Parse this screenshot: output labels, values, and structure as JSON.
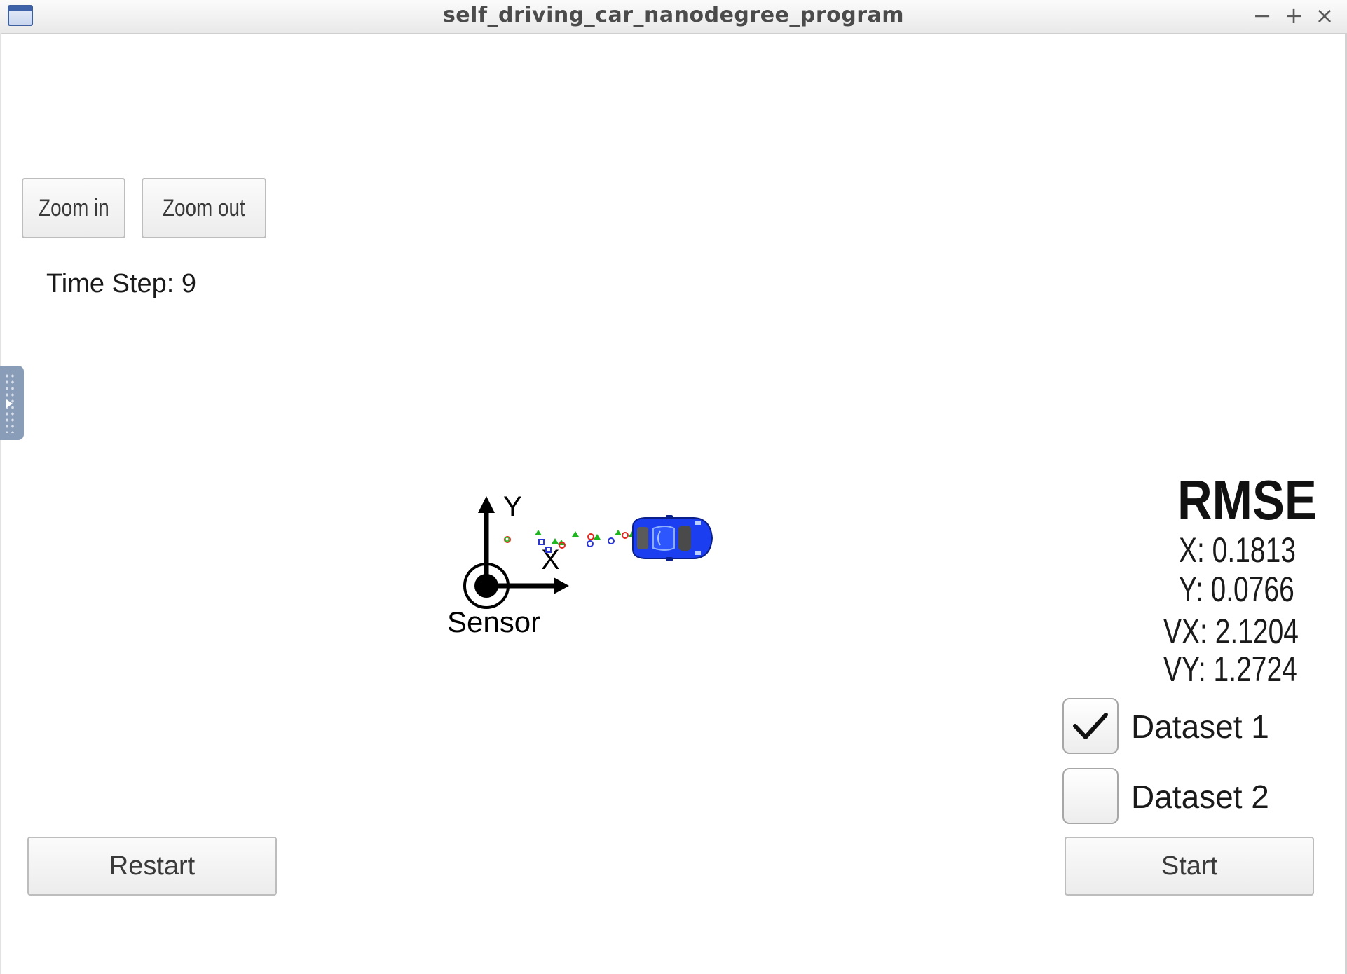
{
  "window": {
    "title": "self_driving_car_nanodegree_program",
    "minimize_label": "−",
    "maximize_label": "+",
    "close_label": "×"
  },
  "toolbar": {
    "zoom_in_label": "Zoom in",
    "zoom_out_label": "Zoom out"
  },
  "status": {
    "time_step": "Time Step: 9"
  },
  "scene": {
    "axis_x_label": "X",
    "axis_y_label": "Y",
    "sensor_label": "Sensor",
    "car_color": "#1a3ef0",
    "lidar_marker_color": "#e0281e",
    "radar_marker_color": "#2a35d8",
    "estimate_marker_color": "#1fb51f"
  },
  "rmse": {
    "title": "RMSE",
    "x": "X: 0.1813",
    "y": "Y: 0.0766",
    "vx": "VX: 2.1204",
    "vy": "VY: 1.2724"
  },
  "datasets": [
    {
      "label": "Dataset 1",
      "checked": true
    },
    {
      "label": "Dataset 2",
      "checked": false
    }
  ],
  "controls": {
    "restart_label": "Restart",
    "start_label": "Start"
  }
}
